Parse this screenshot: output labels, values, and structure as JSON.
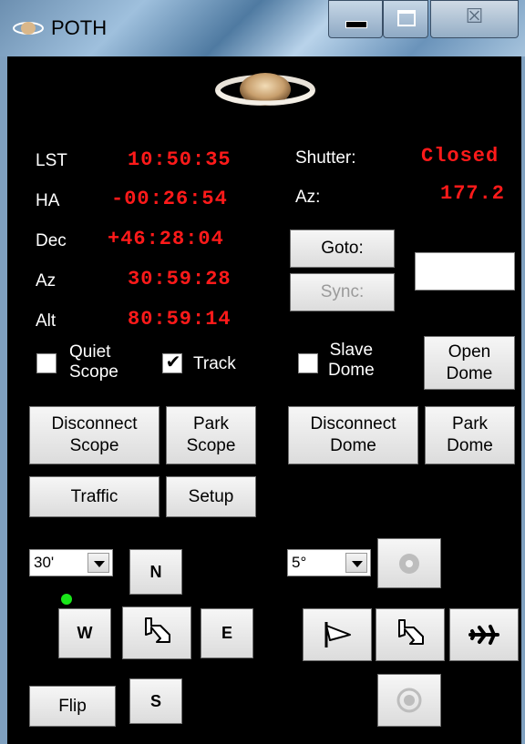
{
  "window": {
    "title": "POTH",
    "close_glyph": "☒",
    "icons": [
      "saturn-icon",
      "minimize-icon",
      "maximize-icon",
      "close-icon",
      "saturn-logo-icon"
    ]
  },
  "telescope": {
    "lst_label": "LST",
    "lst_value": "10:50:35",
    "ha_label": "HA",
    "ha_value": "-00:26:54",
    "dec_label": "Dec",
    "dec_value": "+46:28:04",
    "az_label": "Az",
    "az_value": "30:59:28",
    "alt_label": "Alt",
    "alt_value": "80:59:14"
  },
  "dome": {
    "shutter_label": "Shutter:",
    "shutter_value": "Closed",
    "az_label": "Az:",
    "az_value": "177.2"
  },
  "buttons": {
    "goto": "Goto:",
    "sync": "Sync:",
    "open_dome": "Open\nDome",
    "disconnect_scope": "Disconnect\nScope",
    "park_scope": "Park\nScope",
    "disconnect_dome": "Disconnect\nDome",
    "park_dome": "Park\nDome",
    "traffic": "Traffic",
    "setup": "Setup",
    "flip": "Flip"
  },
  "checkboxes": {
    "quiet_scope": {
      "label": "Quiet\nScope",
      "checked": false
    },
    "track": {
      "label": "Track",
      "checked": true,
      "mark": "✔"
    },
    "slave_dome": {
      "label": "Slave\nDome",
      "checked": false
    }
  },
  "goto_input": {
    "value": ""
  },
  "scope_nudge": {
    "step": "30'",
    "north": "N",
    "west": "W",
    "east": "E",
    "south": "S",
    "connected_indicator_color": "#19e619"
  },
  "dome_nudge": {
    "step": "5°"
  },
  "colors": {
    "readout": "#ff1a1a",
    "background": "#000000",
    "label": "#ffffff"
  }
}
